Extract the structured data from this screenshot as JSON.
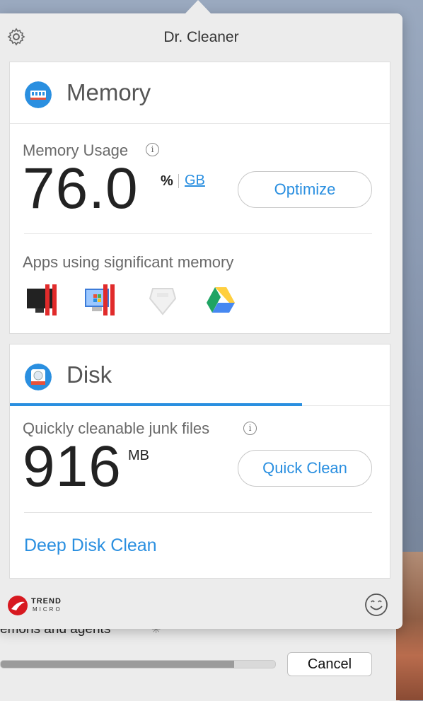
{
  "app": {
    "title": "Dr. Cleaner"
  },
  "memory": {
    "title": "Memory",
    "usage_label": "Memory Usage",
    "value": "76.0",
    "unit_percent": "%",
    "unit_gb": "GB",
    "optimize_label": "Optimize",
    "apps_label": "Apps using significant memory",
    "apps": [
      "parallels-desktop-icon",
      "parallels-windows-vm-icon",
      "generic-app-icon",
      "google-drive-icon"
    ]
  },
  "disk": {
    "title": "Disk",
    "junk_label": "Quickly cleanable junk files",
    "value": "916",
    "unit": "MB",
    "quick_clean_label": "Quick Clean",
    "deep_clean_label": "Deep Disk Clean",
    "progress": 0.77
  },
  "footer": {
    "brand_line1": "TREND",
    "brand_line2": "MICRO"
  },
  "background_window": {
    "status_text": "emons and agents",
    "cancel_label": "Cancel",
    "progress": 0.85
  },
  "colors": {
    "accent": "#2a8fe0",
    "brand_red": "#d71920"
  }
}
